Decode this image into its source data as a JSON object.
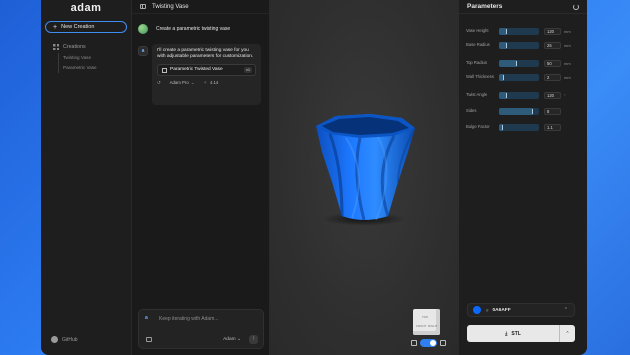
{
  "app": {
    "logo": "adam"
  },
  "sidebar": {
    "new_creation": "New Creation",
    "section_title": "Creations",
    "items": [
      {
        "label": "Twisting Vase"
      },
      {
        "label": "Parametric Vase"
      }
    ],
    "github": "GitHub"
  },
  "chat": {
    "title": "Twisting Vase",
    "user_message": "Create a parametric twisting vase",
    "bot_message": "I'll create a parametric twisting vase for you with adjustable parameters for customization.",
    "artifact_title": "Parametric Twisted Vase",
    "artifact_version": "v1",
    "model": "Adam Pro",
    "file_version": "4.14",
    "composer_placeholder": "Keep iterating with Adam...",
    "composer_model": "Adam"
  },
  "viewport": {
    "vase_color": "#0A6AFF",
    "cube_faces": {
      "front": "FRONT",
      "right": "RIGHT",
      "top": "TOP"
    }
  },
  "params": {
    "title": "Parameters",
    "rows": [
      {
        "label": "Vase Height",
        "value": "120",
        "unit": "mm",
        "fraction": 0.2
      },
      {
        "label": "Base Radius",
        "value": "25",
        "unit": "mm",
        "fraction": 0.2
      },
      {
        "label": "Top Radius",
        "value": "50",
        "unit": "mm",
        "fraction": 0.45
      },
      {
        "label": "Wall Thickness",
        "value": "2",
        "unit": "mm",
        "fraction": 0.12
      },
      {
        "label": "Twist Angle",
        "value": "120",
        "unit": "°",
        "fraction": 0.2
      },
      {
        "label": "Sides",
        "value": "8",
        "unit": "",
        "fraction": 0.85
      },
      {
        "label": "Bulge Factor",
        "value": "1.1",
        "unit": "",
        "fraction": 0.1
      }
    ],
    "color_hex": "0A6AFF",
    "color": "#0A6AFF",
    "export_label": "STL"
  }
}
